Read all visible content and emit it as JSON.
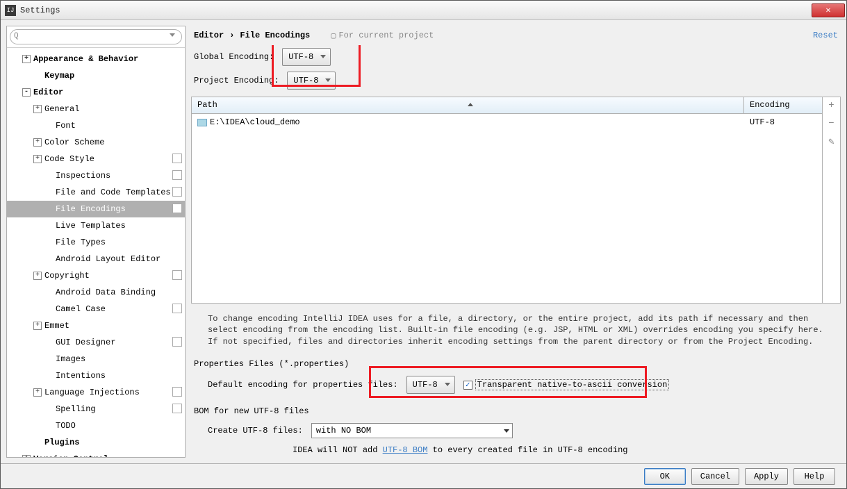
{
  "window": {
    "title": "Settings"
  },
  "breadcrumb": {
    "parent": "Editor",
    "current": "File Encodings",
    "scope": "For current project",
    "reset": "Reset"
  },
  "encodings": {
    "global_label": "Global Encoding:",
    "global_value": "UTF-8",
    "project_label": "Project Encoding:",
    "project_value": "UTF-8"
  },
  "table": {
    "col_path": "Path",
    "col_encoding": "Encoding",
    "rows": [
      {
        "path": "E:\\IDEA\\cloud_demo",
        "encoding": "UTF-8"
      }
    ]
  },
  "help": "To change encoding IntelliJ IDEA uses for a file, a directory, or the entire project, add its path if necessary and then select encoding from the encoding list. Built-in file encoding (e.g. JSP, HTML or XML) overrides encoding you specify here. If not specified, files and directories inherit encoding settings from the parent directory or from the Project Encoding.",
  "properties": {
    "section": "Properties Files (*.properties)",
    "default_label": "Default encoding for properties files:",
    "default_value": "UTF-8",
    "transparent": "Transparent native-to-ascii conversion"
  },
  "bom": {
    "section": "BOM for new UTF-8 files",
    "create_label": "Create UTF-8 files:",
    "create_value": "with NO BOM",
    "help_pre": "IDEA will NOT add ",
    "help_link": "UTF-8 BOM",
    "help_post": " to every created file in UTF-8 encoding"
  },
  "footer": {
    "ok": "OK",
    "cancel": "Cancel",
    "apply": "Apply",
    "help": "Help"
  },
  "tree": [
    {
      "label": "Appearance & Behavior",
      "indent": 1,
      "toggle": "+",
      "bold": true
    },
    {
      "label": "Keymap",
      "indent": 2,
      "bold": true
    },
    {
      "label": "Editor",
      "indent": 1,
      "toggle": "-",
      "bold": true
    },
    {
      "label": "General",
      "indent": 2,
      "toggle": "+"
    },
    {
      "label": "Font",
      "indent": 3
    },
    {
      "label": "Color Scheme",
      "indent": 2,
      "toggle": "+"
    },
    {
      "label": "Code Style",
      "indent": 2,
      "toggle": "+",
      "copy": true
    },
    {
      "label": "Inspections",
      "indent": 3,
      "copy": true
    },
    {
      "label": "File and Code Templates",
      "indent": 3,
      "copy": true
    },
    {
      "label": "File Encodings",
      "indent": 3,
      "copy": true,
      "selected": true
    },
    {
      "label": "Live Templates",
      "indent": 3
    },
    {
      "label": "File Types",
      "indent": 3
    },
    {
      "label": "Android Layout Editor",
      "indent": 3
    },
    {
      "label": "Copyright",
      "indent": 2,
      "toggle": "+",
      "copy": true
    },
    {
      "label": "Android Data Binding",
      "indent": 3
    },
    {
      "label": "Camel Case",
      "indent": 3,
      "copy": true
    },
    {
      "label": "Emmet",
      "indent": 2,
      "toggle": "+"
    },
    {
      "label": "GUI Designer",
      "indent": 3,
      "copy": true
    },
    {
      "label": "Images",
      "indent": 3
    },
    {
      "label": "Intentions",
      "indent": 3
    },
    {
      "label": "Language Injections",
      "indent": 2,
      "toggle": "+",
      "copy": true
    },
    {
      "label": "Spelling",
      "indent": 3,
      "copy": true
    },
    {
      "label": "TODO",
      "indent": 3
    },
    {
      "label": "Plugins",
      "indent": 2,
      "bold": true
    },
    {
      "label": "Version Control",
      "indent": 1,
      "toggle": "+",
      "bold": true
    }
  ]
}
